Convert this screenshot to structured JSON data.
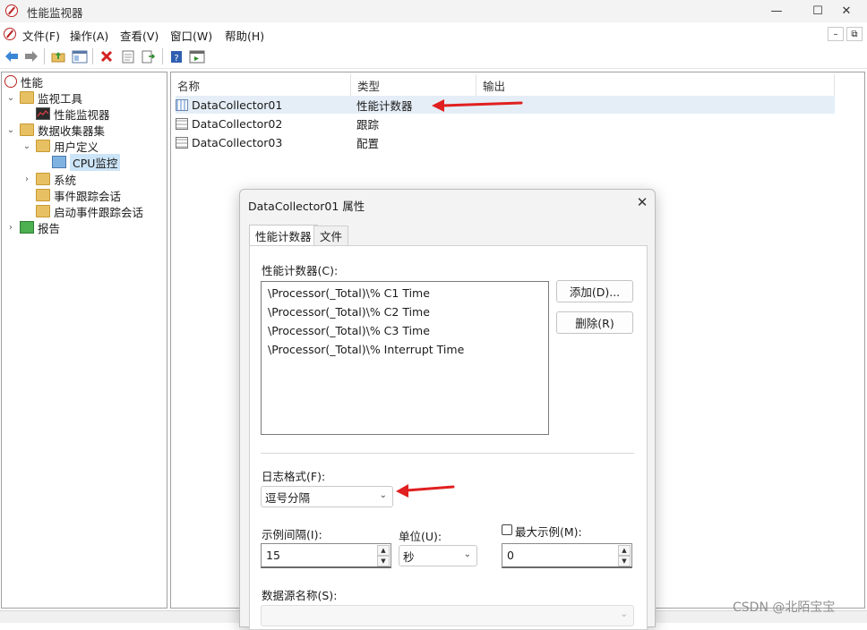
{
  "window": {
    "title": "性能监视器",
    "controls": {
      "minimize": "—",
      "maximize": "☐",
      "close": "✕"
    }
  },
  "menu": [
    "文件(F)",
    "操作(A)",
    "查看(V)",
    "窗口(W)",
    "帮助(H)"
  ],
  "mdi_controls": {
    "minimize": "–",
    "restore": "⧉"
  },
  "toolbar_icons": [
    "back-arrow-icon",
    "forward-arrow-icon",
    "up-folder-icon",
    "show-hide-tree-icon",
    "delete-icon",
    "properties-icon",
    "export-list-icon",
    "help-icon",
    "show-hide-action-pane-icon"
  ],
  "tree": {
    "root": "性能",
    "items": [
      {
        "label": "监视工具"
      },
      {
        "label": "性能监视器"
      },
      {
        "label": "数据收集器集"
      },
      {
        "label": "用户定义"
      },
      {
        "label": "CPU监控"
      },
      {
        "label": "系统"
      },
      {
        "label": "事件跟踪会话"
      },
      {
        "label": "启动事件跟踪会话"
      },
      {
        "label": "报告"
      }
    ]
  },
  "list": {
    "columns": [
      "名称",
      "类型",
      "输出"
    ],
    "rows": [
      {
        "name": "DataCollector01",
        "type": "性能计数器"
      },
      {
        "name": "DataCollector02",
        "type": "跟踪"
      },
      {
        "name": "DataCollector03",
        "type": "配置"
      }
    ]
  },
  "dialog": {
    "title": "DataCollector01 属性",
    "tabs": [
      "性能计数器",
      "文件"
    ],
    "counters_label": "性能计数器(C):",
    "counters": [
      "\\Processor(_Total)\\% C1 Time",
      "\\Processor(_Total)\\% C2 Time",
      "\\Processor(_Total)\\% C3 Time",
      "\\Processor(_Total)\\% Interrupt Time"
    ],
    "add_button": "添加(D)...",
    "remove_button": "删除(R)",
    "log_format_label": "日志格式(F):",
    "log_format_value": "逗号分隔",
    "sample_interval_label": "示例间隔(I):",
    "sample_interval_value": "15",
    "units_label": "单位(U):",
    "units_value": "秒",
    "max_samples_label": "最大示例(M):",
    "max_samples_value": "0",
    "data_source_label": "数据源名称(S):"
  },
  "watermark": "CSDN @北陌宝宝",
  "colors": {
    "selection": "#cce4f7",
    "annotation_arrow": "#e02020",
    "dialog_bg": "#f3f3f3"
  }
}
